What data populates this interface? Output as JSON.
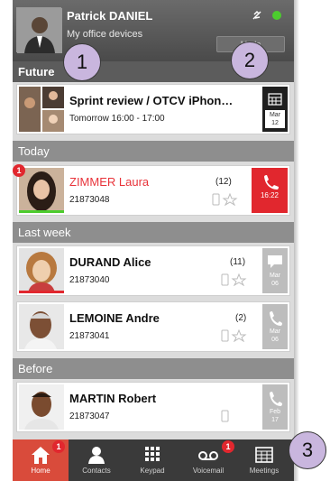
{
  "header": {
    "name": "Patrick DANIEL",
    "subtitle": "My office devices",
    "mode_button": "Mode",
    "icons": {
      "avatar": "user-avatar",
      "mute": "mute-icon",
      "presence": "presence-dot"
    },
    "presence_color": "#4ccc2e"
  },
  "sections": {
    "future": "Future",
    "today": "Today",
    "last_week": "Last week",
    "before": "Before"
  },
  "items": [
    {
      "title": "Sprint review / OTCV iPhon…",
      "detail": "Tomorrow 16:00 - 17:00",
      "action": "Mar\n12",
      "action_type": "meeting"
    },
    {
      "title": "ZIMMER Laura",
      "detail": "21873048",
      "count": "(12)",
      "action": "16:22",
      "action_type": "missed-call",
      "badge": "1"
    },
    {
      "title": "DURAND Alice",
      "detail": "21873040",
      "count": "(11)",
      "action": "Mar\n06",
      "action_type": "message"
    },
    {
      "title": "LEMOINE Andre",
      "detail": "21873041",
      "count": "(2)",
      "action": "Mar\n06",
      "action_type": "call"
    },
    {
      "title": "MARTIN Robert",
      "detail": "21873047",
      "count": "",
      "action": "Feb\n17",
      "action_type": "call"
    }
  ],
  "nav": [
    {
      "label": "Home",
      "icon": "home-icon",
      "badge": "1",
      "active": true
    },
    {
      "label": "Contacts",
      "icon": "contacts-icon",
      "badge": "",
      "active": false
    },
    {
      "label": "Keypad",
      "icon": "keypad-icon",
      "badge": "",
      "active": false
    },
    {
      "label": "Voicemail",
      "icon": "voicemail-icon",
      "badge": "1",
      "active": false
    },
    {
      "label": "Meetings",
      "icon": "meetings-icon",
      "badge": "",
      "active": false
    }
  ],
  "callouts": [
    "1",
    "2",
    "3"
  ],
  "colors": {
    "accent_red": "#e1272e",
    "active_tab": "#d94b3b",
    "callout": "#c9b6de"
  }
}
